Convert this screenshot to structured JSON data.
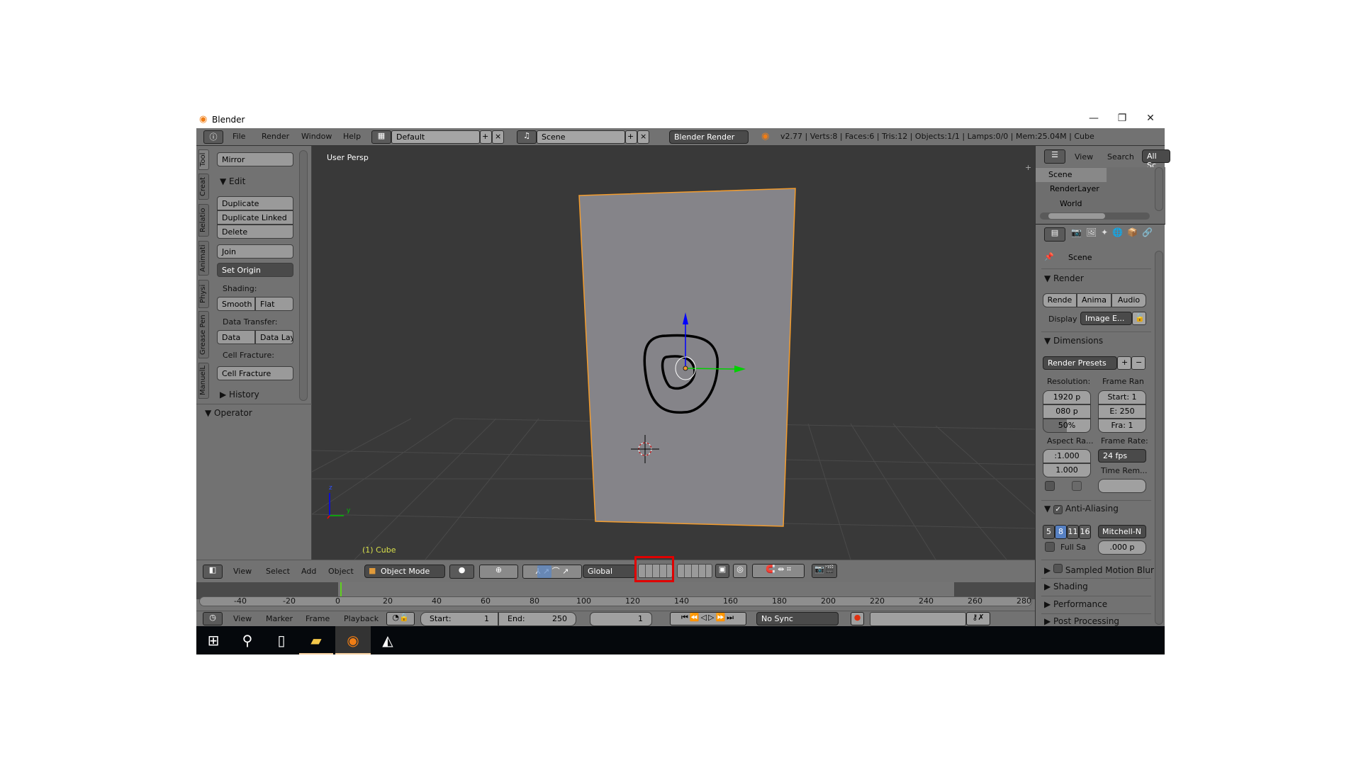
{
  "window": {
    "title": "Blender",
    "minimize": "—",
    "maximize": "❐",
    "close": "✕"
  },
  "topbar": {
    "menus": [
      "File",
      "Render",
      "Window",
      "Help"
    ],
    "layout": "Default",
    "scene": "Scene",
    "engine": "Blender Render",
    "stats": "v2.77 | Verts:8 | Faces:6 | Tris:12 | Objects:1/1 | Lamps:0/0 | Mem:25.04M | Cube"
  },
  "toolbar": {
    "tabs": [
      "Tool",
      "Creat",
      "Relatio",
      "Animati",
      "Physi",
      "Grease Pen",
      "ManuelL"
    ],
    "mirror": "Mirror",
    "edit": "Edit",
    "duplicate": "Duplicate",
    "duplicate_linked": "Duplicate Linked",
    "delete": "Delete",
    "join": "Join",
    "set_origin": "Set Origin",
    "shading_label": "Shading:",
    "smooth": "Smooth",
    "flat": "Flat",
    "data_transfer_label": "Data Transfer:",
    "data": "Data",
    "data_lay": "Data Lay",
    "cell_fracture_label": "Cell Fracture:",
    "cell_fracture": "Cell Fracture",
    "history": "History",
    "operator": "Operator"
  },
  "viewport": {
    "view_name": "User Persp",
    "object_label": "(1) Cube",
    "axis_z": "z",
    "axis_y": "y",
    "colors": {
      "selection": "#f39c2d",
      "x_axis": "#ff0000",
      "y_axis": "#00d000",
      "z_axis": "#0000ff",
      "highlight_box": "#e00000"
    }
  },
  "viewport_header": {
    "menus": [
      "View",
      "Select",
      "Add",
      "Object"
    ],
    "mode": "Object Mode",
    "orientation": "Global"
  },
  "timeline": {
    "ruler": [
      "-40",
      "-20",
      "0",
      "20",
      "40",
      "60",
      "80",
      "100",
      "120",
      "140",
      "160",
      "180",
      "200",
      "220",
      "240",
      "260",
      "280"
    ],
    "current_frame": 1
  },
  "timeline_header": {
    "menus": [
      "View",
      "Marker",
      "Frame",
      "Playback"
    ],
    "start_label": "Start:",
    "start": "1",
    "end_label": "End:",
    "end": "250",
    "current": "1",
    "sync": "No Sync"
  },
  "outliner": {
    "view": "View",
    "search": "Search",
    "filter": "All Sc",
    "items": [
      "Scene",
      "RenderLayer",
      "World"
    ]
  },
  "properties": {
    "context": "Scene",
    "render_header": "Render",
    "render_btn": "Rende",
    "anim_btn": "Anima",
    "audio_btn": "Audio",
    "display_label": "Display",
    "display_value": "Image E...",
    "dimensions": "Dimensions",
    "presets": "Render Presets",
    "resolution_label": "Resolution:",
    "res_x": "1920 p",
    "res_y": "080 p",
    "res_pct": "50%",
    "frame_range_label": "Frame Ran",
    "start": "Start: 1",
    "end": "E: 250",
    "frame": "Fra:  1",
    "aspect_label": "Aspect Ra...",
    "aspect_x": ":1.000",
    "aspect_y": "1.000",
    "frame_rate_label": "Frame Rate:",
    "fps": "24 fps",
    "time_remap_label": "Time Rem...",
    "aa_header": "Anti-Aliasing",
    "aa_samples": [
      "5",
      "8",
      "11",
      "16"
    ],
    "aa_selected": "8",
    "filter": "Mitchell-N",
    "full_sample": "Full Sa",
    "filter_size": ".000 p",
    "sections": [
      "Sampled Motion Blur",
      "Shading",
      "Performance",
      "Post Processing"
    ]
  },
  "taskbar": {
    "icons": [
      "windows-start",
      "search",
      "task-view",
      "file-explorer",
      "blender",
      "unity"
    ]
  }
}
